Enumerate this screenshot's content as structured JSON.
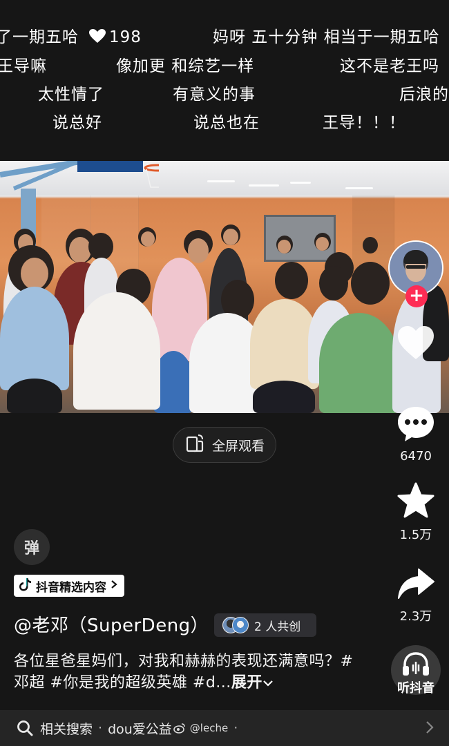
{
  "danmaku": [
    {
      "text": "了一期五哈",
      "count": "198"
    },
    {
      "text": "妈呀 五十分钟 相当于一期五哈"
    },
    {
      "text": "王导嘛"
    },
    {
      "text": "像加更 和综艺一样"
    },
    {
      "text": "这不是老王吗"
    },
    {
      "text": "太性情了"
    },
    {
      "text": "有意义的事"
    },
    {
      "text": "后浪的"
    },
    {
      "text": "说总好"
    },
    {
      "text": "说总也在"
    },
    {
      "text": "王导！！！"
    }
  ],
  "video": {
    "fullscreen_label": "全屏观看"
  },
  "rail": {
    "comment_count": "6470",
    "favorite_count": "1.5万",
    "share_count": "2.3万",
    "music_label": "听抖音"
  },
  "danmaku_toggle": "弹",
  "tag_label": "抖音精选内容",
  "author": "@老邓（SuperDeng）",
  "cocreate_label": "2 人共创",
  "description": "各位星爸星妈们，对我和赫赫的表现还满意吗？#邓超 #你是我的超级英雄 #d...",
  "expand_label": "展开",
  "related": {
    "label": "相关搜索",
    "query": "dou爱公益",
    "watermark": "@leche"
  },
  "colors": {
    "background": "#161616",
    "accent_red": "#fe2c55",
    "tag_bg": "#ffffff"
  }
}
